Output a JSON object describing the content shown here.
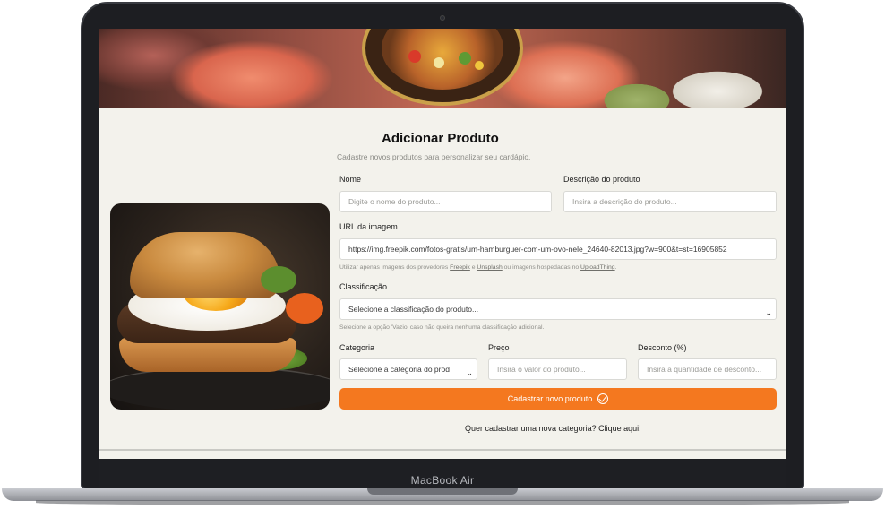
{
  "device": {
    "brand_label": "MacBook Air"
  },
  "hero": {
    "logo": "restaurant-logo"
  },
  "page": {
    "title": "Adicionar Produto",
    "subtitle": "Cadastre novos produtos para personalizar seu cardápio."
  },
  "image": {
    "alt": "hamburger-with-egg"
  },
  "form": {
    "name": {
      "label": "Nome",
      "placeholder": "Digite o nome do produto..."
    },
    "description": {
      "label": "Descrição do produto",
      "placeholder": "Insira a descrição do produto..."
    },
    "image_url": {
      "label": "URL da imagem",
      "value": "https://img.freepik.com/fotos-gratis/um-hamburguer-com-um-ovo-nele_24640-82013.jpg?w=900&t=st=16905852",
      "hint_prefix": "Utilizar apenas imagens dos provedores",
      "hint_provider1": "Freepik",
      "hint_and": "e",
      "hint_provider2": "Unsplash",
      "hint_middle": "ou imagens hospedadas no",
      "hint_provider3": "UploadThing",
      "hint_suffix": "."
    },
    "classification": {
      "label": "Classificação",
      "selected": "Selecione a classificação do produto...",
      "hint": "Selecione a opção 'Vazio' caso não queira nenhuma classificação adicional."
    },
    "category": {
      "label": "Categoria",
      "selected": "Selecione a categoria do prod"
    },
    "price": {
      "label": "Preço",
      "placeholder": "Insira o valor do produto..."
    },
    "discount": {
      "label": "Desconto (%)",
      "placeholder": "Insira a quantidade de desconto..."
    },
    "submit_label": "Cadastrar novo produto"
  },
  "footer": {
    "category_link": "Quer cadastrar uma nova categoria? Clique aqui!"
  },
  "colors": {
    "accent": "#f4781f",
    "background": "#f3f2ec"
  }
}
